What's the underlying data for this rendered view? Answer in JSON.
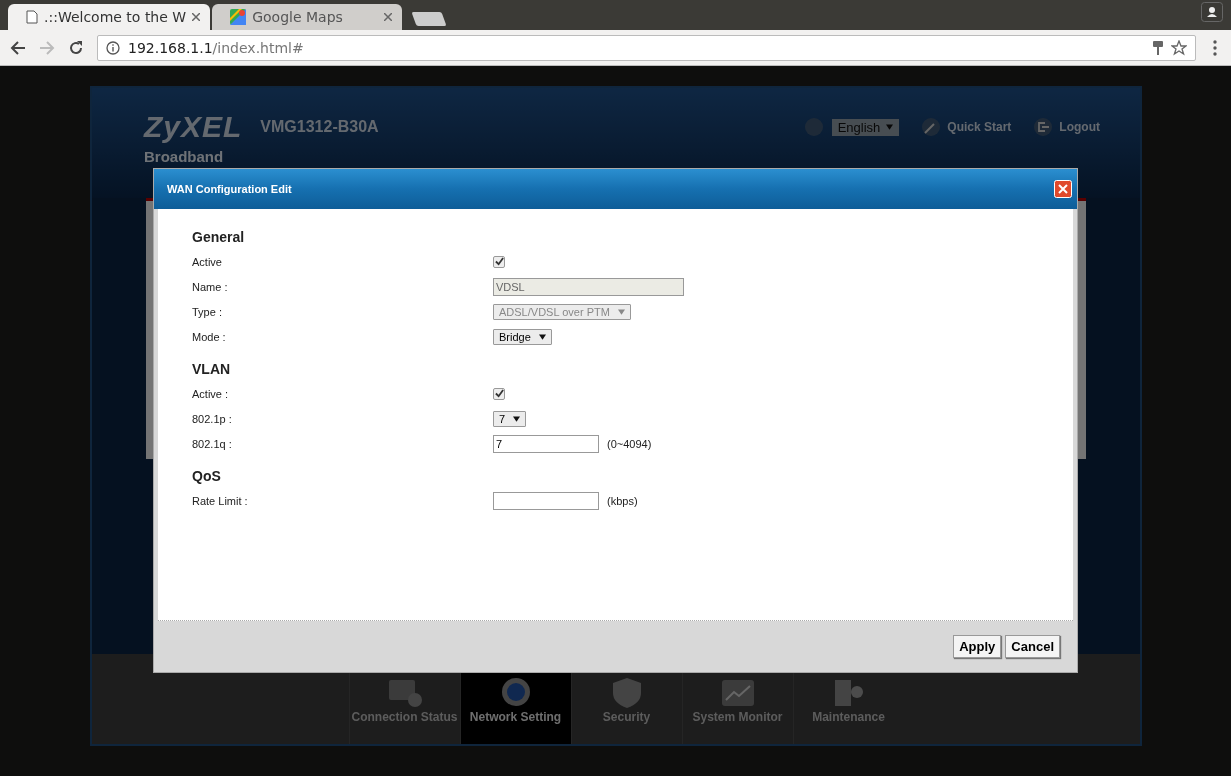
{
  "browser": {
    "tabs": [
      {
        "title": ".::Welcome to the W",
        "selected": true
      },
      {
        "title": "Google Maps",
        "selected": false
      }
    ],
    "url": {
      "host": "192.168.1.1",
      "path": "/index.html#"
    }
  },
  "router": {
    "brand": "ZyXEL",
    "model": "VMG1312-B30A",
    "language": "English",
    "links": [
      {
        "label": "Quick Start"
      },
      {
        "label": "Logout"
      }
    ],
    "page_title": "Broadband",
    "nav": [
      {
        "label": "Connection Status",
        "selected": false
      },
      {
        "label": "Network Setting",
        "selected": true
      },
      {
        "label": "Security",
        "selected": false
      },
      {
        "label": "System Monitor",
        "selected": false
      },
      {
        "label": "Maintenance",
        "selected": false
      }
    ]
  },
  "dialog": {
    "title": "WAN Configuration Edit",
    "sections": [
      {
        "heading": "General",
        "fields": [
          {
            "label": "Active",
            "kind": "checkbox",
            "checked": true
          },
          {
            "label": "Name :",
            "kind": "text",
            "value": "VDSL",
            "disabled": true
          },
          {
            "label": "Type :",
            "kind": "select",
            "value": "ADSL/VDSL over PTM",
            "disabled": true
          },
          {
            "label": "Mode :",
            "kind": "select",
            "value": "Bridge",
            "disabled": false
          }
        ]
      },
      {
        "heading": "VLAN",
        "fields": [
          {
            "label": "Active :",
            "kind": "checkbox",
            "checked": true
          },
          {
            "label": "802.1p :",
            "kind": "select",
            "value": "7",
            "disabled": false
          },
          {
            "label": "802.1q :",
            "kind": "text",
            "value": "7",
            "disabled": false,
            "hint": "(0~4094)"
          }
        ]
      },
      {
        "heading": "QoS",
        "fields": [
          {
            "label": "Rate Limit :",
            "kind": "text",
            "disabled": false,
            "hint": "(kbps)"
          }
        ]
      }
    ],
    "buttons": [
      "Apply",
      "Cancel"
    ]
  }
}
